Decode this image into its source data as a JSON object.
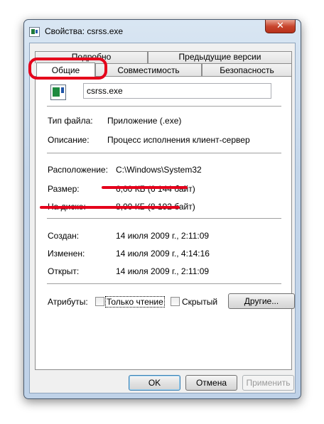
{
  "window": {
    "title": "Свойства: csrss.exe",
    "close_glyph": "✕"
  },
  "tabs": {
    "row_back": [
      "Подробно",
      "Предыдущие версии"
    ],
    "row_front": [
      "Общие",
      "Совместимость",
      "Безопасность"
    ],
    "active": "Общие"
  },
  "general": {
    "file_name": "csrss.exe",
    "file_type_label": "Тип файла:",
    "file_type_value": "Приложение (.exe)",
    "description_label": "Описание:",
    "description_value": "Процесс исполнения клиент-сервер",
    "location_label": "Расположение:",
    "location_value": "C:\\Windows\\System32",
    "size_label": "Размер:",
    "size_value": "6,00 КБ (6 144 байт)",
    "disk_label": "На диске:",
    "disk_value": "8,00 КБ (8 192 байт)",
    "created_label": "Создан:",
    "created_value": "14 июля 2009 г., 2:11:09",
    "modified_label": "Изменен:",
    "modified_value": "14 июля 2009 г., 4:14:16",
    "opened_label": "Открыт:",
    "opened_value": "14 июля 2009 г., 2:11:09",
    "attributes_label": "Атрибуты:",
    "readonly_label": "Только чтение",
    "readonly_checked": false,
    "hidden_label": "Скрытый",
    "hidden_checked": false,
    "other_button": "Другие..."
  },
  "buttons": {
    "ok": "OK",
    "cancel": "Отмена",
    "apply": "Применить"
  },
  "annotation_color": "#e5001b"
}
